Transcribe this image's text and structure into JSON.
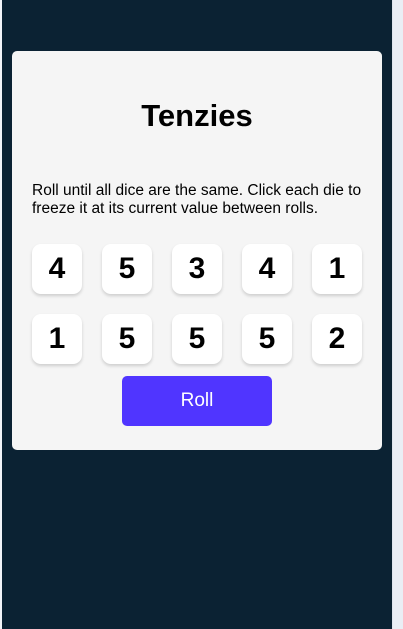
{
  "game": {
    "title": "Tenzies",
    "instructions": "Roll until all dice are the same. Click each die to freeze it at its current value between rolls.",
    "dice": [
      4,
      5,
      3,
      4,
      1,
      1,
      5,
      5,
      5,
      2
    ],
    "roll_label": "Roll"
  },
  "colors": {
    "background": "#0b2233",
    "card": "#f5f5f5",
    "die_face": "#ffffff",
    "button": "#5035ff",
    "button_text": "#ffffff"
  }
}
